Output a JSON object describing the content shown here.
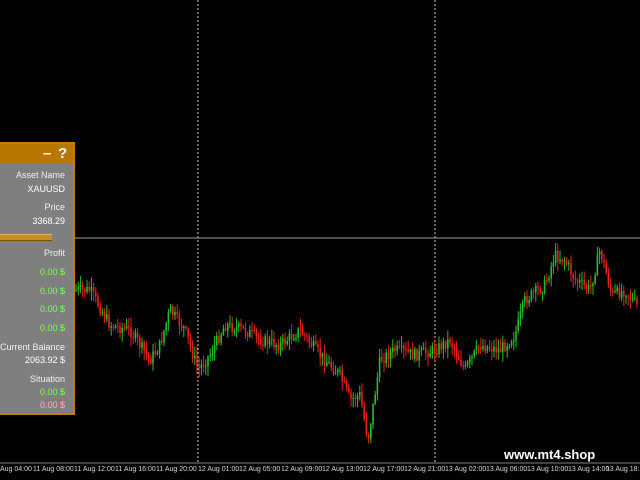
{
  "chart": {
    "background": "#000000",
    "bull_color": "#22c02a",
    "bear_color": "#e82020",
    "grid_color": "#c8c8c8",
    "price_line_color": "#a0a0a0",
    "x_labels": [
      "Aug 04:00",
      "11 Aug 08:00",
      "11 Aug 12:00",
      "11 Aug 16:00",
      "11 Aug 20:00",
      "12 Aug 01:00",
      "12 Aug 05:00",
      "12 Aug 09:00",
      "12 Aug 13:00",
      "12 Aug 17:00",
      "12 Aug 21:00",
      "13 Aug 02:00",
      "13 Aug 06:00",
      "13 Aug 10:00",
      "13 Aug 14:00",
      "13 Aug 18:"
    ]
  },
  "panel": {
    "minimize_label": "–",
    "help_label": "?",
    "asset_name_label": "Asset Name",
    "asset_name_value": "XAUUSD",
    "price_label": "Price",
    "price_value": "3368.29",
    "profit_label": "Profit",
    "profit_values": [
      "0.00 $",
      "0.00 $",
      "0.00 $",
      "0.00 $"
    ],
    "current_balance_label": "Current Balance",
    "current_balance_value": "2063.92 $",
    "situation_label": "Situation",
    "situation_values": [
      "0.00 $",
      "0.00 $"
    ],
    "accent_color": "#b77700",
    "panel_color": "#7f7f7f"
  },
  "watermark": "www.mt4.shop"
}
